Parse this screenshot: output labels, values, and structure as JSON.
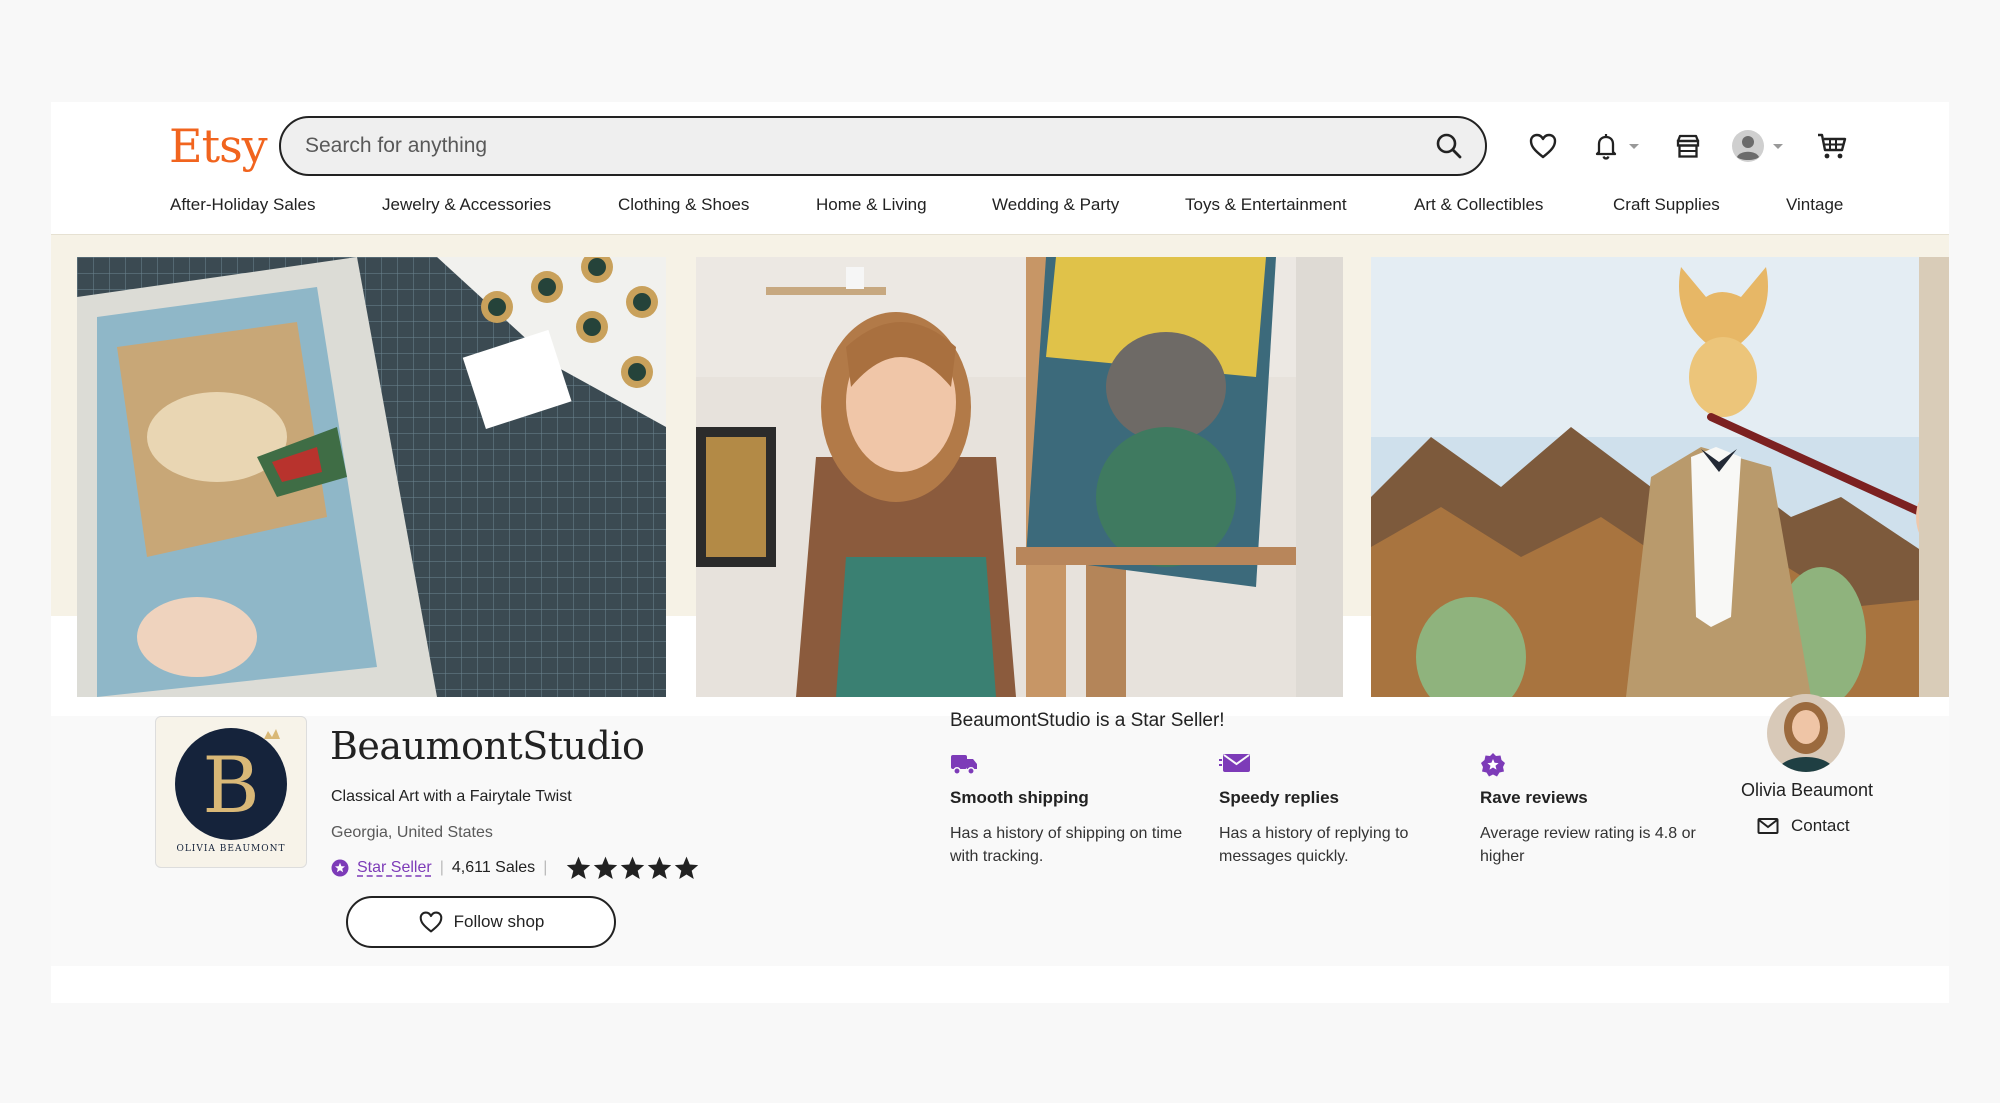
{
  "header": {
    "logo": "Etsy",
    "search_placeholder": "Search for anything"
  },
  "nav": {
    "items": [
      "After-Holiday Sales",
      "Jewelry & Accessories",
      "Clothing & Shoes",
      "Home & Living",
      "Wedding & Party",
      "Toys & Entertainment",
      "Art & Collectibles",
      "Craft Supplies",
      "Vintage"
    ]
  },
  "shop": {
    "name": "BeaumontStudio",
    "tagline": "Classical Art with a Fairytale Twist",
    "location": "Georgia, United States",
    "star_seller_label": "Star Seller",
    "sales": "4,611 Sales",
    "rating_stars": 5,
    "follow_label": "Follow shop",
    "logo_monogram": "B",
    "logo_text": "OLIVIA BEAUMONT"
  },
  "star_seller": {
    "heading": "BeaumontStudio is a Star Seller!",
    "features": [
      {
        "icon": "truck-icon",
        "title": "Smooth shipping",
        "desc": "Has a history of shipping on time with tracking."
      },
      {
        "icon": "envelope-icon",
        "title": "Speedy replies",
        "desc": "Has a history of replying to messages quickly."
      },
      {
        "icon": "star-badge-icon",
        "title": "Rave reviews",
        "desc": "Average review rating is 4.8 or higher"
      }
    ]
  },
  "owner": {
    "name": "Olivia Beaumont",
    "contact_label": "Contact"
  },
  "colors": {
    "brand": "#f1641e",
    "star_seller": "#7d3bb8"
  }
}
